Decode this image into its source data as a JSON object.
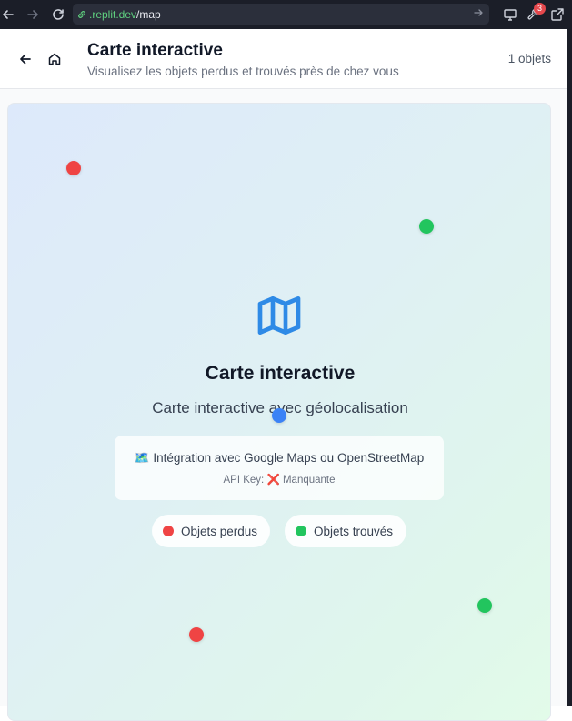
{
  "browser": {
    "url_domain": ".replit.dev",
    "url_path": "/map",
    "notification_count": "3"
  },
  "header": {
    "title": "Carte interactive",
    "subtitle": "Visualisez les objets perdus et trouvés près de chez vous",
    "object_count": "1 objets",
    "back_icon": "arrow-left-icon",
    "home_icon": "home-icon"
  },
  "map": {
    "icon": "map-icon",
    "title": "Carte interactive",
    "description": "Carte interactive avec géolocalisation",
    "integration_emoji": "🗺️",
    "integration_text": "Intégration avec Google Maps ou OpenStreetMap",
    "api_key_label": "API Key:",
    "api_key_status_icon": "❌",
    "api_key_status": "Manquante",
    "legend": [
      {
        "label": "Objets perdus",
        "color": "#ef4444"
      },
      {
        "label": "Objets trouvés",
        "color": "#22c55e"
      }
    ],
    "pin_colors": {
      "lost": "#ef4444",
      "found": "#22c55e",
      "user": "#3b82f6"
    }
  }
}
